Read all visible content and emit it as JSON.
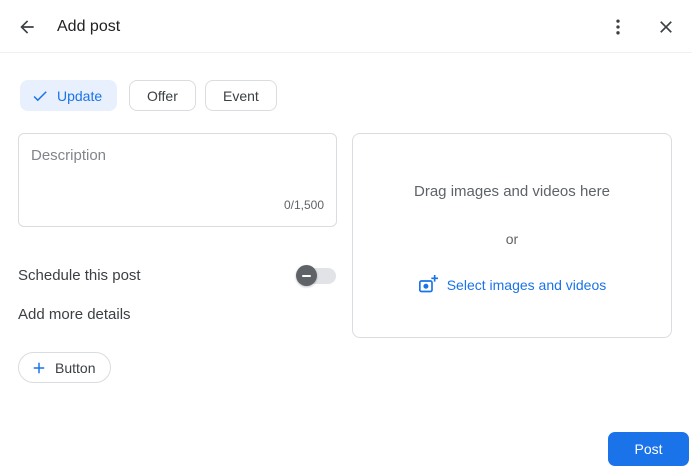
{
  "header": {
    "title": "Add post",
    "back_icon": "arrow-left",
    "menu_icon": "kebab-vertical",
    "close_icon": "close-x"
  },
  "post_types": [
    {
      "label": "Update",
      "selected": true,
      "icon": "checkmark"
    },
    {
      "label": "Offer",
      "selected": false
    },
    {
      "label": "Event",
      "selected": false
    }
  ],
  "description": {
    "placeholder": "Description",
    "value": "",
    "char_counter": "0/1,500"
  },
  "media_dropzone": {
    "drag_text": "Drag images and videos here",
    "or_text": "or",
    "select_label": "Select images and videos",
    "select_icon": "add-photo-icon"
  },
  "options": {
    "schedule_label": "Schedule this post",
    "schedule_enabled": false,
    "more_details_label": "Add more details"
  },
  "add_button_chip": {
    "label": "Button",
    "icon": "plus"
  },
  "footer": {
    "post_label": "Post"
  },
  "colors": {
    "accent_blue": "#1a73e8",
    "selected_chip_bg": "#e8f0fe",
    "border_gray": "#dadce0",
    "text_primary": "#202124",
    "text_label": "#3c4043",
    "text_secondary": "#5f6368",
    "toggle_track": "#e1e3e6",
    "toggle_thumb": "#5f6368"
  }
}
